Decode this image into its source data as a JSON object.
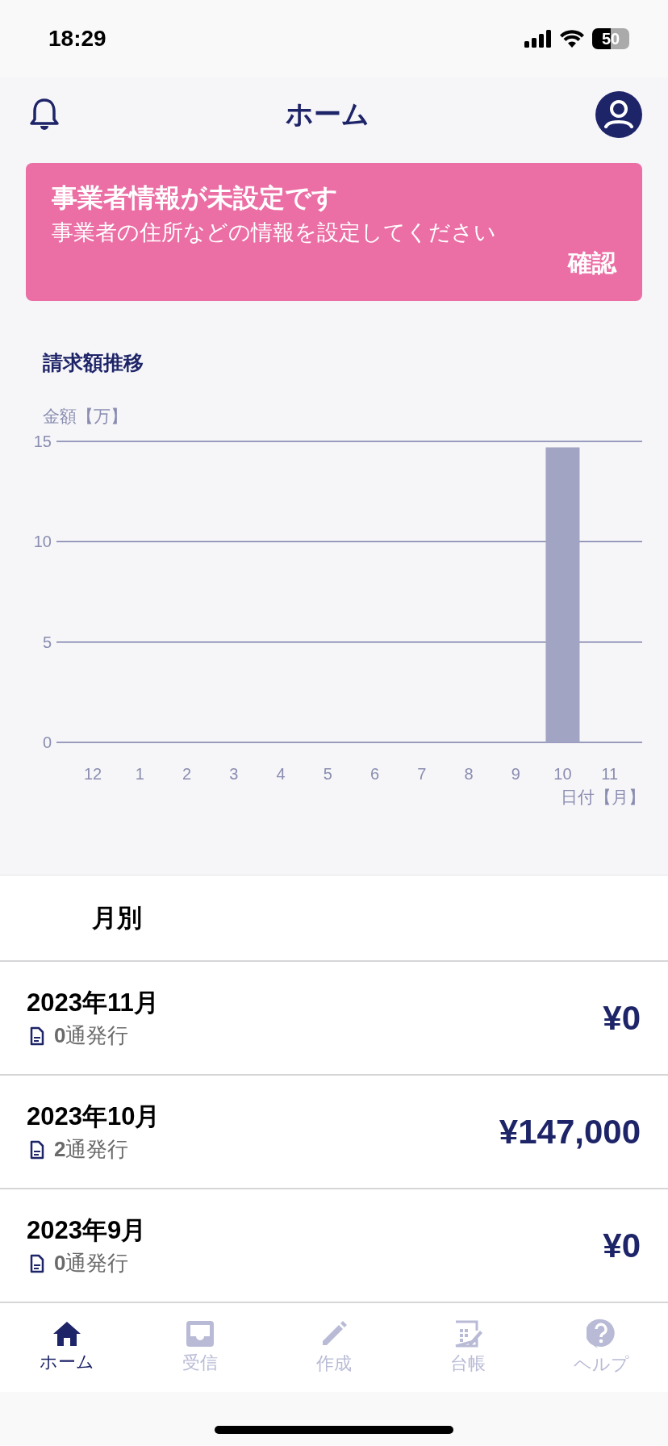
{
  "status_bar": {
    "time": "18:29",
    "battery": "50"
  },
  "header": {
    "title": "ホーム"
  },
  "banner": {
    "title": "事業者情報が未設定です",
    "message": "事業者の住所などの情報を設定してください",
    "action": "確認"
  },
  "chart": {
    "title": "請求額推移",
    "chart_data": {
      "type": "bar",
      "ylabel": "金額【万】",
      "xlabel": "日付【月】",
      "categories": [
        "12",
        "1",
        "2",
        "3",
        "4",
        "5",
        "6",
        "7",
        "8",
        "9",
        "10",
        "11"
      ],
      "series": [
        {
          "color": "#a1a4c2",
          "values": [
            0,
            0,
            0,
            0,
            0,
            0,
            0,
            0,
            0,
            0,
            14.7,
            0
          ]
        }
      ],
      "ylim": [
        0,
        15
      ],
      "yticks": [
        0,
        5,
        10,
        15
      ]
    }
  },
  "monthly": {
    "heading": "月別",
    "rows": [
      {
        "month": "2023年11月",
        "count": "0",
        "count_suffix": "通発行",
        "amount": "¥0"
      },
      {
        "month": "2023年10月",
        "count": "2",
        "count_suffix": "通発行",
        "amount": "¥147,000"
      },
      {
        "month": "2023年9月",
        "count": "0",
        "count_suffix": "通発行",
        "amount": "¥0"
      }
    ]
  },
  "tabs": [
    {
      "label": "ホーム",
      "kind": "home",
      "selected": true
    },
    {
      "label": "受信",
      "kind": "inbox",
      "selected": false
    },
    {
      "label": "作成",
      "kind": "create",
      "selected": false
    },
    {
      "label": "台帳",
      "kind": "ledger",
      "selected": false
    },
    {
      "label": "ヘルプ",
      "kind": "help",
      "selected": false
    }
  ]
}
